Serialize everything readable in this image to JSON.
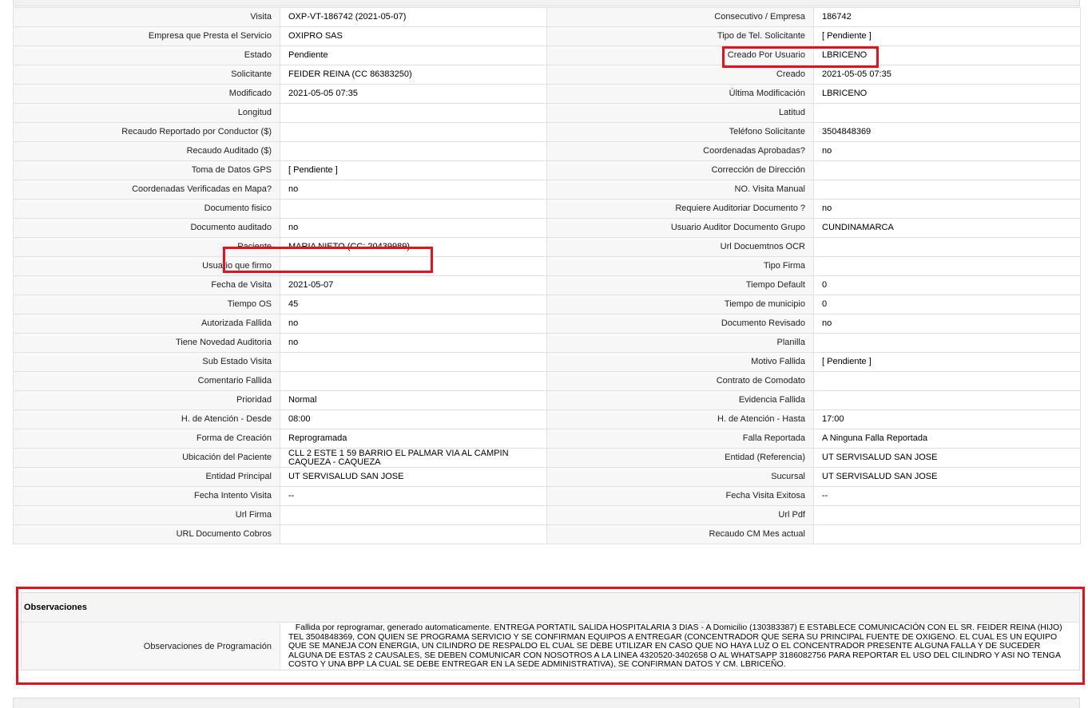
{
  "details": {
    "rows": [
      {
        "left_label": "Visita",
        "left_value": "OXP-VT-186742 (2021-05-07)",
        "right_label": "Consecutivo / Empresa",
        "right_value": "186742"
      },
      {
        "left_label": "Empresa que Presta el Servicio",
        "left_value": "OXIPRO SAS",
        "right_label": "Tipo de Tel. Solicitante",
        "right_value": "[ Pendiente ]"
      },
      {
        "left_label": "Estado",
        "left_value": "Pendiente",
        "right_label": "Creado Por Usuario",
        "right_value": "LBRICENO"
      },
      {
        "left_label": "Solicitante",
        "left_value": "FEIDER REINA (CC 86383250)",
        "right_label": "Creado",
        "right_value": "2021-05-05 07:35"
      },
      {
        "left_label": "Modificado",
        "left_value": "2021-05-05 07:35",
        "right_label": "Última Modificación",
        "right_value": " LBRICENO"
      },
      {
        "left_label": "Longitud",
        "left_value": "",
        "right_label": "Latitud",
        "right_value": ""
      },
      {
        "left_label": "Recaudo Reportado por Conductor ($)",
        "left_value": "",
        "right_label": "Teléfono Solicitante",
        "right_value": "3504848369"
      },
      {
        "left_label": "Recaudo Auditado ($)",
        "left_value": "",
        "right_label": "Coordenadas Aprobadas?",
        "right_value": " no"
      },
      {
        "left_label": "Toma de Datos GPS",
        "left_value": "[ Pendiente ]",
        "right_label": "Corrección de Dirección",
        "right_value": ""
      },
      {
        "left_label": "Coordenadas Verificadas en Mapa?",
        "left_value": " no",
        "right_label": "NO. Visita Manual",
        "right_value": ""
      },
      {
        "left_label": "Documento fisico",
        "left_value": "",
        "right_label": "Requiere Auditoriar Documento ?",
        "right_value": " no"
      },
      {
        "left_label": "Documento auditado",
        "left_value": " no",
        "right_label": "Usuario Auditor Documento Grupo",
        "right_value": "CUNDINAMARCA"
      },
      {
        "left_label": "Paciente",
        "left_value": "MARIA NIETO (CC: 20439989)",
        "right_label": "Url Docuemtnos OCR",
        "right_value": ""
      },
      {
        "left_label": "Usuario que firmo",
        "left_value": "",
        "right_label": "Tipo Firma",
        "right_value": ""
      },
      {
        "left_label": "Fecha de Visita",
        "left_value": " 2021-05-07",
        "right_label": "Tiempo Default",
        "right_value": "0"
      },
      {
        "left_label": "Tiempo OS",
        "left_value": "45",
        "right_label": "Tiempo de municipio",
        "right_value": "0"
      },
      {
        "left_label": "Autorizada Fallida",
        "left_value": " no",
        "right_label": "Documento Revisado",
        "right_value": " no"
      },
      {
        "left_label": "Tiene Novedad Auditoria",
        "left_value": " no",
        "right_label": "Planilla",
        "right_value": ""
      },
      {
        "left_label": "Sub Estado Visita",
        "left_value": "",
        "right_label": "Motivo Fallida",
        "right_value": "[ Pendiente ]"
      },
      {
        "left_label": "Comentario Fallida",
        "left_value": "",
        "right_label": "Contrato de Comodato",
        "right_value": ""
      },
      {
        "left_label": "Prioridad",
        "left_value": "Normal",
        "right_label": "Evidencia Fallida",
        "right_value": ""
      },
      {
        "left_label": "H. de Atención - Desde",
        "left_value": "08:00",
        "right_label": "H. de Atención - Hasta",
        "right_value": "17:00"
      },
      {
        "left_label": "Forma de Creación",
        "left_value": "Reprogramada",
        "right_label": "Falla Reportada",
        "right_value": "A Ninguna Falla Reportada"
      },
      {
        "left_label": "Ubicación del Paciente",
        "left_value": "CLL 2 ESTE 1 59 BARRIO EL PALMAR VIA AL CAMPIN CAQUEZA - CAQUEZA",
        "right_label": "Entidad (Referencia)",
        "right_value": "UT SERVISALUD SAN JOSE"
      },
      {
        "left_label": "Entidad Principal",
        "left_value": "UT SERVISALUD SAN JOSE",
        "right_label": "Sucursal",
        "right_value": "UT SERVISALUD SAN JOSE"
      },
      {
        "left_label": "Fecha Intento Visita",
        "left_value": " --",
        "right_label": "Fecha Visita Exitosa",
        "right_value": " --"
      },
      {
        "left_label": "Url Firma",
        "left_value": "",
        "right_label": "Url Pdf",
        "right_value": ""
      },
      {
        "left_label": "URL Documento Cobros",
        "left_value": "",
        "right_label": "Recaudo CM Mes actual",
        "right_value": ""
      }
    ]
  },
  "observaciones": {
    "title": "Observaciones",
    "label": "Observaciones de Programación",
    "value": "Fallida por reprogramar, generado automaticamente. ENTREGA PORTATIL SALIDA HOSPITALARIA 3 DIAS - A Domicilio (130383387) E ESTABLECE COMUNICACIÓN CON EL SR. FEIDER REINA (HIJO) TEL 3504848369, CON QUIEN SE PROGRAMA SERVICIO Y SE CONFIRMAN EQUIPOS A ENTREGAR (CONCENTRADOR QUE SERA SU PRINCIPAL FUENTE DE OXIGENO. EL CUAL ES UN EQUIPO QUE SE MANEJA CON ENERGIA, UN CILINDRO DE RESPALDO EL CUAL SE DEBE UTILIZAR EN CASO QUE NO HAYA LUZ O EL CONCENTRADOR PRESENTE ALGUNA FALLA Y DE SUCEDER ALGUNA DE ESTAS 2 CAUSALES, SE DEBEN COMUNICAR CON NOSOTROS A LA LINEA 4320520-3402658 O AL WHATSAPP 3186082756 PARA REPORTAR EL USO DEL CILINDRO Y ASI NO TENGA COSTO Y UNA BPP LA CUAL SE DEBE ENTREGAR EN LA SEDE ADMINISTRATIVA), SE CONFIRMAN DATOS Y CM. LBRICEÑO."
  },
  "colors": {
    "highlight": "#e5121d",
    "label_bg": "#f7f7f7",
    "border": "#e2e2e2"
  }
}
